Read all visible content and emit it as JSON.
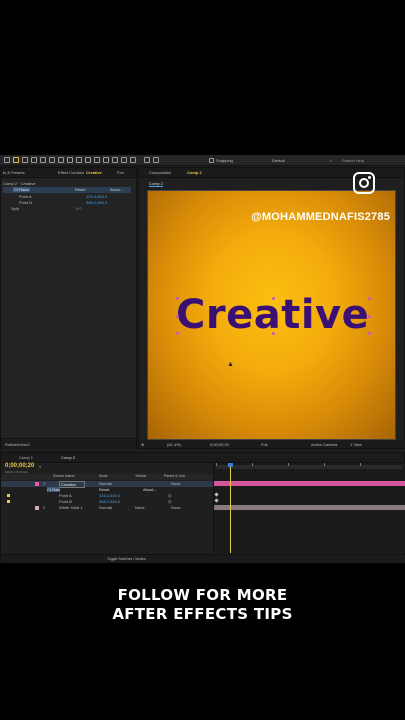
{
  "toolbar": {
    "snapping_label": "Snapping",
    "workspace_label": "Default",
    "search_placeholder": "Search Help"
  },
  "left_panel": {
    "tab_presets": "ts & Presets",
    "tab_effect_controls": "Effect Controls",
    "tab_effect_target": "Creative",
    "tab_fonts": "Fon",
    "comp_path": "Comp 2 · Creative",
    "effect_name": "Ct Raise",
    "reset_label": "Reset",
    "about_label": "About...",
    "point_a_label": "Point A",
    "point_a_value": "123.4,540.0",
    "point_b_label": "Point B",
    "point_b_value": "958.2,540.0",
    "split_label": "Split",
    "split_value": "0.0",
    "footer_label": "RubberHose2"
  },
  "composition": {
    "tab_label": "Composition",
    "tab_name": "Comp 2",
    "breadcrumb": "Comp 2",
    "text_layer": "Creative",
    "zoom": "(61.4%)",
    "timecode": "0;00;00;20",
    "resolution": "Full",
    "camera": "Active Camera",
    "view": "1 View"
  },
  "timeline": {
    "tab_comp1": "Comp 1",
    "tab_comp2": "Comp 2",
    "timecode": "0;00;00;20",
    "fps_info": "00020 (30.00 fps)",
    "col_source_name": "Source Name",
    "col_mode": "Mode",
    "col_trkmat": "TrkMat",
    "col_parent": "Parent & Link",
    "layers": [
      {
        "num": "1",
        "name": "Creative",
        "mode": "Normal",
        "parent": "None"
      },
      {
        "num": "",
        "name": "Ct Rais",
        "mode": "Reset",
        "parent": "About..."
      },
      {
        "num": "",
        "name": "Point A",
        "mode": "123.4,540.0",
        "parent": ""
      },
      {
        "num": "",
        "name": "Point B",
        "mode": "958.2,540.0",
        "parent": ""
      },
      {
        "num": "2",
        "name": "White Solid 1",
        "mode": "Normal",
        "trkmat": "None",
        "parent": "None"
      }
    ],
    "footer_label": "Toggle Switches / Modes"
  },
  "overlay": {
    "watermark": "@MOHAMMEDNAFIS2785",
    "caption_line1": "FOLLOW FOR MORE",
    "caption_line2": "AFTER EFFECTS TIPS",
    "icon": "instagram-icon"
  },
  "colors": {
    "accent_blue": "#4aa3e8",
    "timecode_yellow": "#e8c94a",
    "layer_pink": "#e85aa8",
    "text_purple": "#3a1075",
    "comp_bg_yellow": "#f4ac0c"
  }
}
